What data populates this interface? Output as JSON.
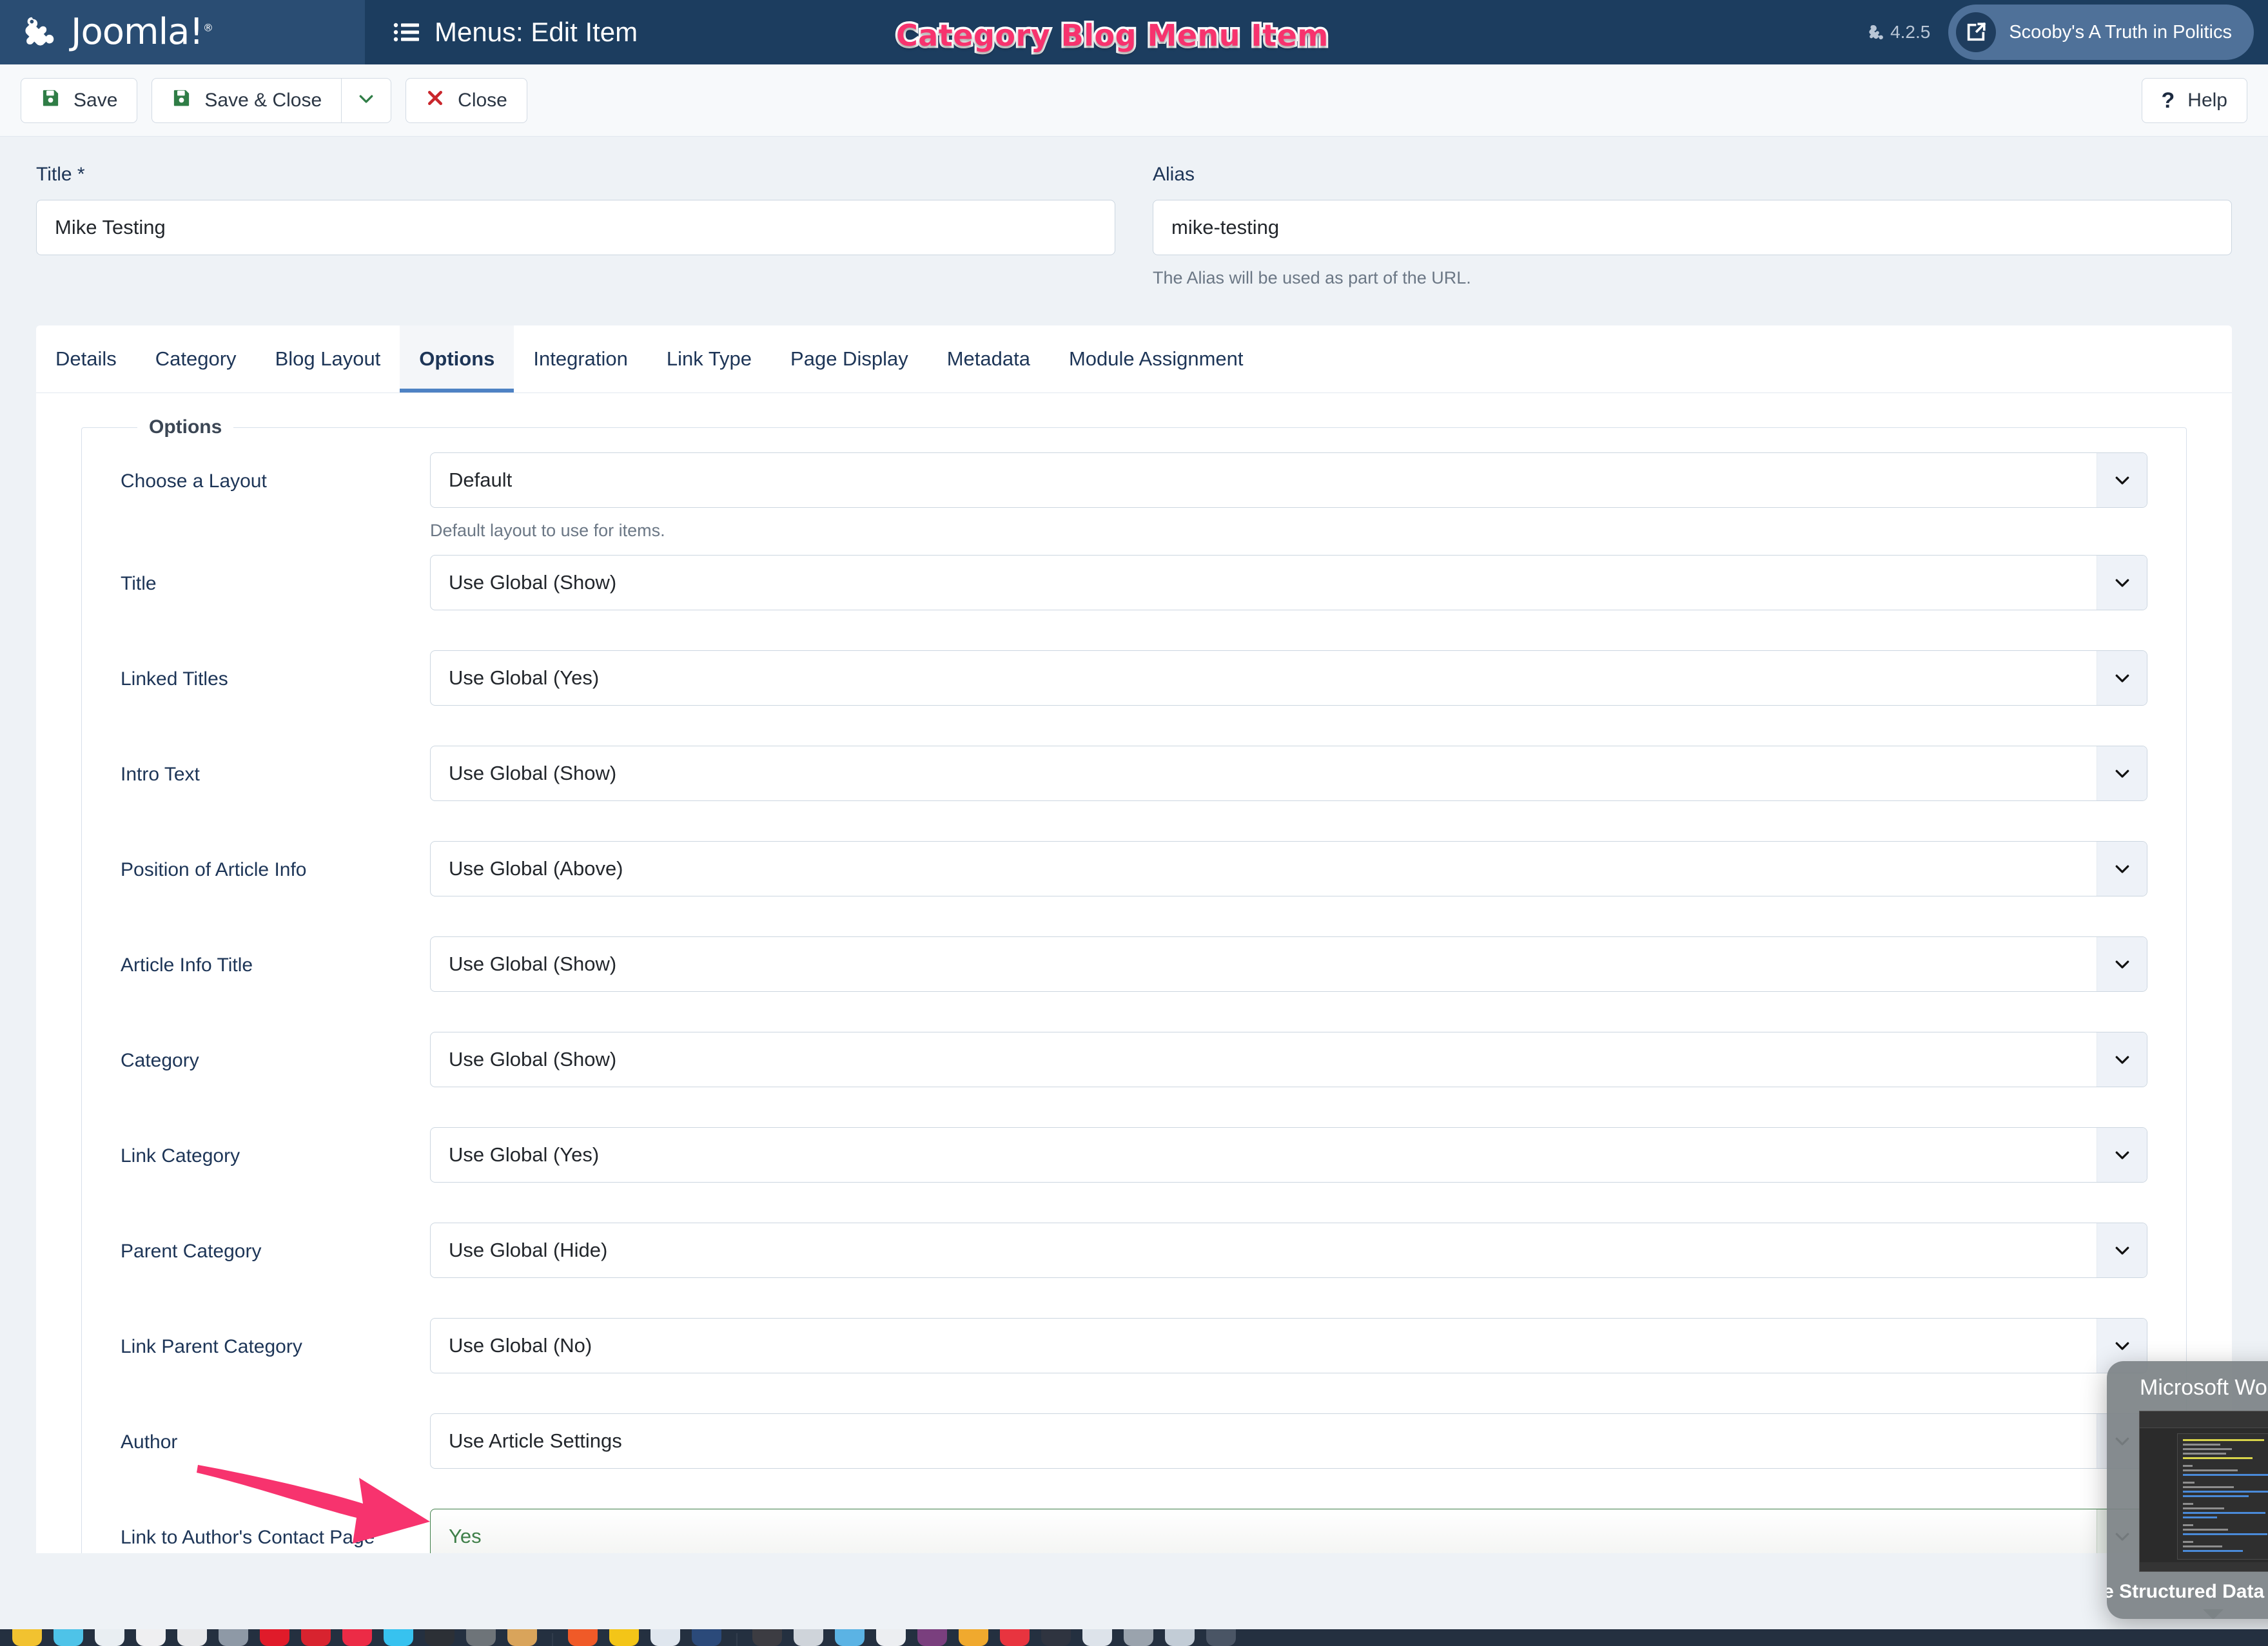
{
  "header": {
    "brand_name": "Joomla!",
    "brand_icon": "joomla-logo-icon",
    "page_icon": "list-icon",
    "page_title": "Menus: Edit Item",
    "version_label": "4.2.5",
    "version_icon": "joomla-mark-icon",
    "site_link_label": "Scooby's A Truth in Politics",
    "site_link_icon": "external-link-icon"
  },
  "annotation": {
    "overlay_title": "Category Blog Menu Item",
    "overlay_color": "#f7336e",
    "arrow_color": "#f7336e",
    "arrow_icon": "pink-arrow-icon"
  },
  "toolbar": {
    "save_label": "Save",
    "save_icon": "floppy-disk-icon",
    "save_close_label": "Save & Close",
    "save_close_icon": "floppy-disk-icon",
    "save_dropdown_icon": "chevron-down-icon",
    "close_label": "Close",
    "close_icon": "x-mark-icon",
    "help_label": "Help",
    "help_icon": "question-mark-icon"
  },
  "form": {
    "title_label": "Title *",
    "title_value": "Mike Testing",
    "alias_label": "Alias",
    "alias_value": "mike-testing",
    "alias_help": "The Alias will be used as part of the URL."
  },
  "tabs": [
    {
      "label": "Details",
      "active": false
    },
    {
      "label": "Category",
      "active": false
    },
    {
      "label": "Blog Layout",
      "active": false
    },
    {
      "label": "Options",
      "active": true
    },
    {
      "label": "Integration",
      "active": false
    },
    {
      "label": "Link Type",
      "active": false
    },
    {
      "label": "Page Display",
      "active": false
    },
    {
      "label": "Metadata",
      "active": false
    },
    {
      "label": "Module Assignment",
      "active": false
    }
  ],
  "options": {
    "legend": "Options",
    "rows": [
      {
        "label": "Choose a Layout",
        "value": "Default",
        "help": "Default layout to use for items.",
        "state": "normal"
      },
      {
        "label": "Title",
        "value": "Use Global (Show)",
        "help": "",
        "state": "normal"
      },
      {
        "label": "Linked Titles",
        "value": "Use Global (Yes)",
        "help": "",
        "state": "normal"
      },
      {
        "label": "Intro Text",
        "value": "Use Global (Show)",
        "help": "",
        "state": "normal"
      },
      {
        "label": "Position of Article Info",
        "value": "Use Global (Above)",
        "help": "",
        "state": "normal"
      },
      {
        "label": "Article Info Title",
        "value": "Use Global (Show)",
        "help": "",
        "state": "normal"
      },
      {
        "label": "Category",
        "value": "Use Global (Show)",
        "help": "",
        "state": "normal"
      },
      {
        "label": "Link Category",
        "value": "Use Global (Yes)",
        "help": "",
        "state": "normal"
      },
      {
        "label": "Parent Category",
        "value": "Use Global (Hide)",
        "help": "",
        "state": "normal"
      },
      {
        "label": "Link Parent Category",
        "value": "Use Global (No)",
        "help": "",
        "state": "normal"
      },
      {
        "label": "Author",
        "value": "Use Article Settings",
        "help": "",
        "state": "normal"
      },
      {
        "label": "Link to Author's Contact Page",
        "value": "Yes",
        "help": "",
        "state": "ok"
      }
    ],
    "dropdown_icon": "chevron-down-icon",
    "ok_color": "#3f7f49"
  },
  "dock_preview": {
    "app_name": "Microsoft Word",
    "doc_name": "Google Structured Data ROI Results"
  }
}
